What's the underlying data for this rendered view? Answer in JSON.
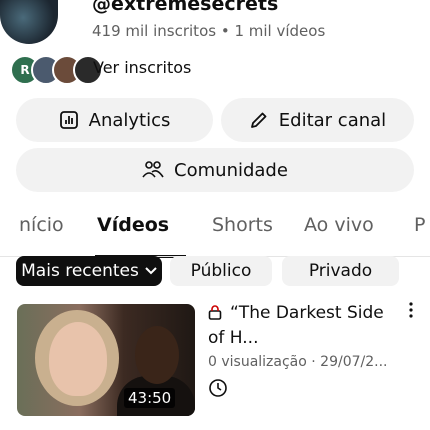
{
  "channel": {
    "handle": "@extremesecrets",
    "stats": "419 mil inscritos • 1 mil vídeos",
    "subscribers_link": "Ver inscritos",
    "avatars": [
      {
        "letter": "R",
        "color": "#2f6f4f"
      },
      {
        "letter": "",
        "color": "#4b5a6e"
      },
      {
        "letter": "",
        "color": "#6b4b3a"
      },
      {
        "letter": "",
        "color": "#2a2a2a"
      }
    ]
  },
  "buttons": {
    "analytics": "Analytics",
    "edit_channel": "Editar canal",
    "community": "Comunidade"
  },
  "tabs": [
    {
      "label": "nício",
      "active": false
    },
    {
      "label": "Vídeos",
      "active": true
    },
    {
      "label": "Shorts",
      "active": false
    },
    {
      "label": "Ao vivo",
      "active": false
    },
    {
      "label": "P",
      "active": false
    }
  ],
  "filters": {
    "sort": "Mais recentes",
    "public": "Público",
    "private": "Privado"
  },
  "video": {
    "title": "“The Darkest Side of H...",
    "meta": "0 visualização · 29/07/2...",
    "duration": "43:50",
    "visibility_icon": "lock-icon"
  }
}
